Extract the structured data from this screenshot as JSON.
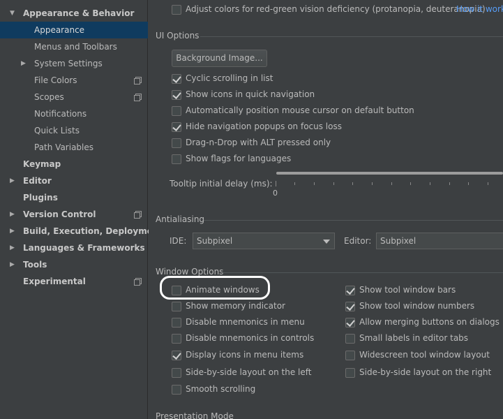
{
  "sidebar": {
    "items": [
      {
        "label": "Appearance & Behavior",
        "arrow": "▼"
      },
      {
        "label": "Appearance"
      },
      {
        "label": "Menus and Toolbars"
      },
      {
        "label": "System Settings",
        "arrow": "▶"
      },
      {
        "label": "File Colors"
      },
      {
        "label": "Scopes"
      },
      {
        "label": "Notifications"
      },
      {
        "label": "Quick Lists"
      },
      {
        "label": "Path Variables"
      },
      {
        "label": "Keymap"
      },
      {
        "label": "Editor",
        "arrow": "▶"
      },
      {
        "label": "Plugins"
      },
      {
        "label": "Version Control",
        "arrow": "▶"
      },
      {
        "label": "Build, Execution, Deployment",
        "arrow": "▶"
      },
      {
        "label": "Languages & Frameworks",
        "arrow": "▶"
      },
      {
        "label": "Tools",
        "arrow": "▶"
      },
      {
        "label": "Experimental"
      }
    ]
  },
  "top": {
    "color_deficiency_label": "Adjust colors for red-green vision deficiency (protanopia, deuteranopia)",
    "how_it_works": "How it works"
  },
  "ui_options": {
    "title": "UI Options",
    "background_button": "Background Image...",
    "cyclic_scrolling": "Cyclic scrolling in list",
    "show_icons_nav": "Show icons in quick navigation",
    "auto_position_mouse": "Automatically position mouse cursor on default button",
    "hide_nav_popups": "Hide navigation popups on focus loss",
    "drag_drop_alt": "Drag-n-Drop with ALT pressed only",
    "show_flags": "Show flags for languages",
    "tooltip_delay_label": "Tooltip initial delay (ms):",
    "tooltip_min": "0"
  },
  "antialiasing": {
    "title": "Antialiasing",
    "ide_label": "IDE:",
    "ide_value": "Subpixel",
    "editor_label": "Editor:",
    "editor_value": "Subpixel"
  },
  "window_options": {
    "title": "Window Options",
    "animate_windows": "Animate windows",
    "show_memory": "Show memory indicator",
    "disable_mnemonics_menu": "Disable mnemonics in menu",
    "disable_mnemonics_controls": "Disable mnemonics in controls",
    "display_icons_menu": "Display icons in menu items",
    "side_by_side_left": "Side-by-side layout on the left",
    "smooth_scrolling": "Smooth scrolling",
    "show_tool_bars": "Show tool window bars",
    "show_tool_numbers": "Show tool window numbers",
    "allow_merging": "Allow merging buttons on dialogs",
    "small_labels": "Small labels in editor tabs",
    "widescreen_layout": "Widescreen tool window layout",
    "side_by_side_right": "Side-by-side layout on the right"
  },
  "presentation_mode": {
    "title": "Presentation Mode"
  },
  "colors": {
    "background": "#3c3f41",
    "selected": "#0f3b5f",
    "link": "#589df6"
  }
}
